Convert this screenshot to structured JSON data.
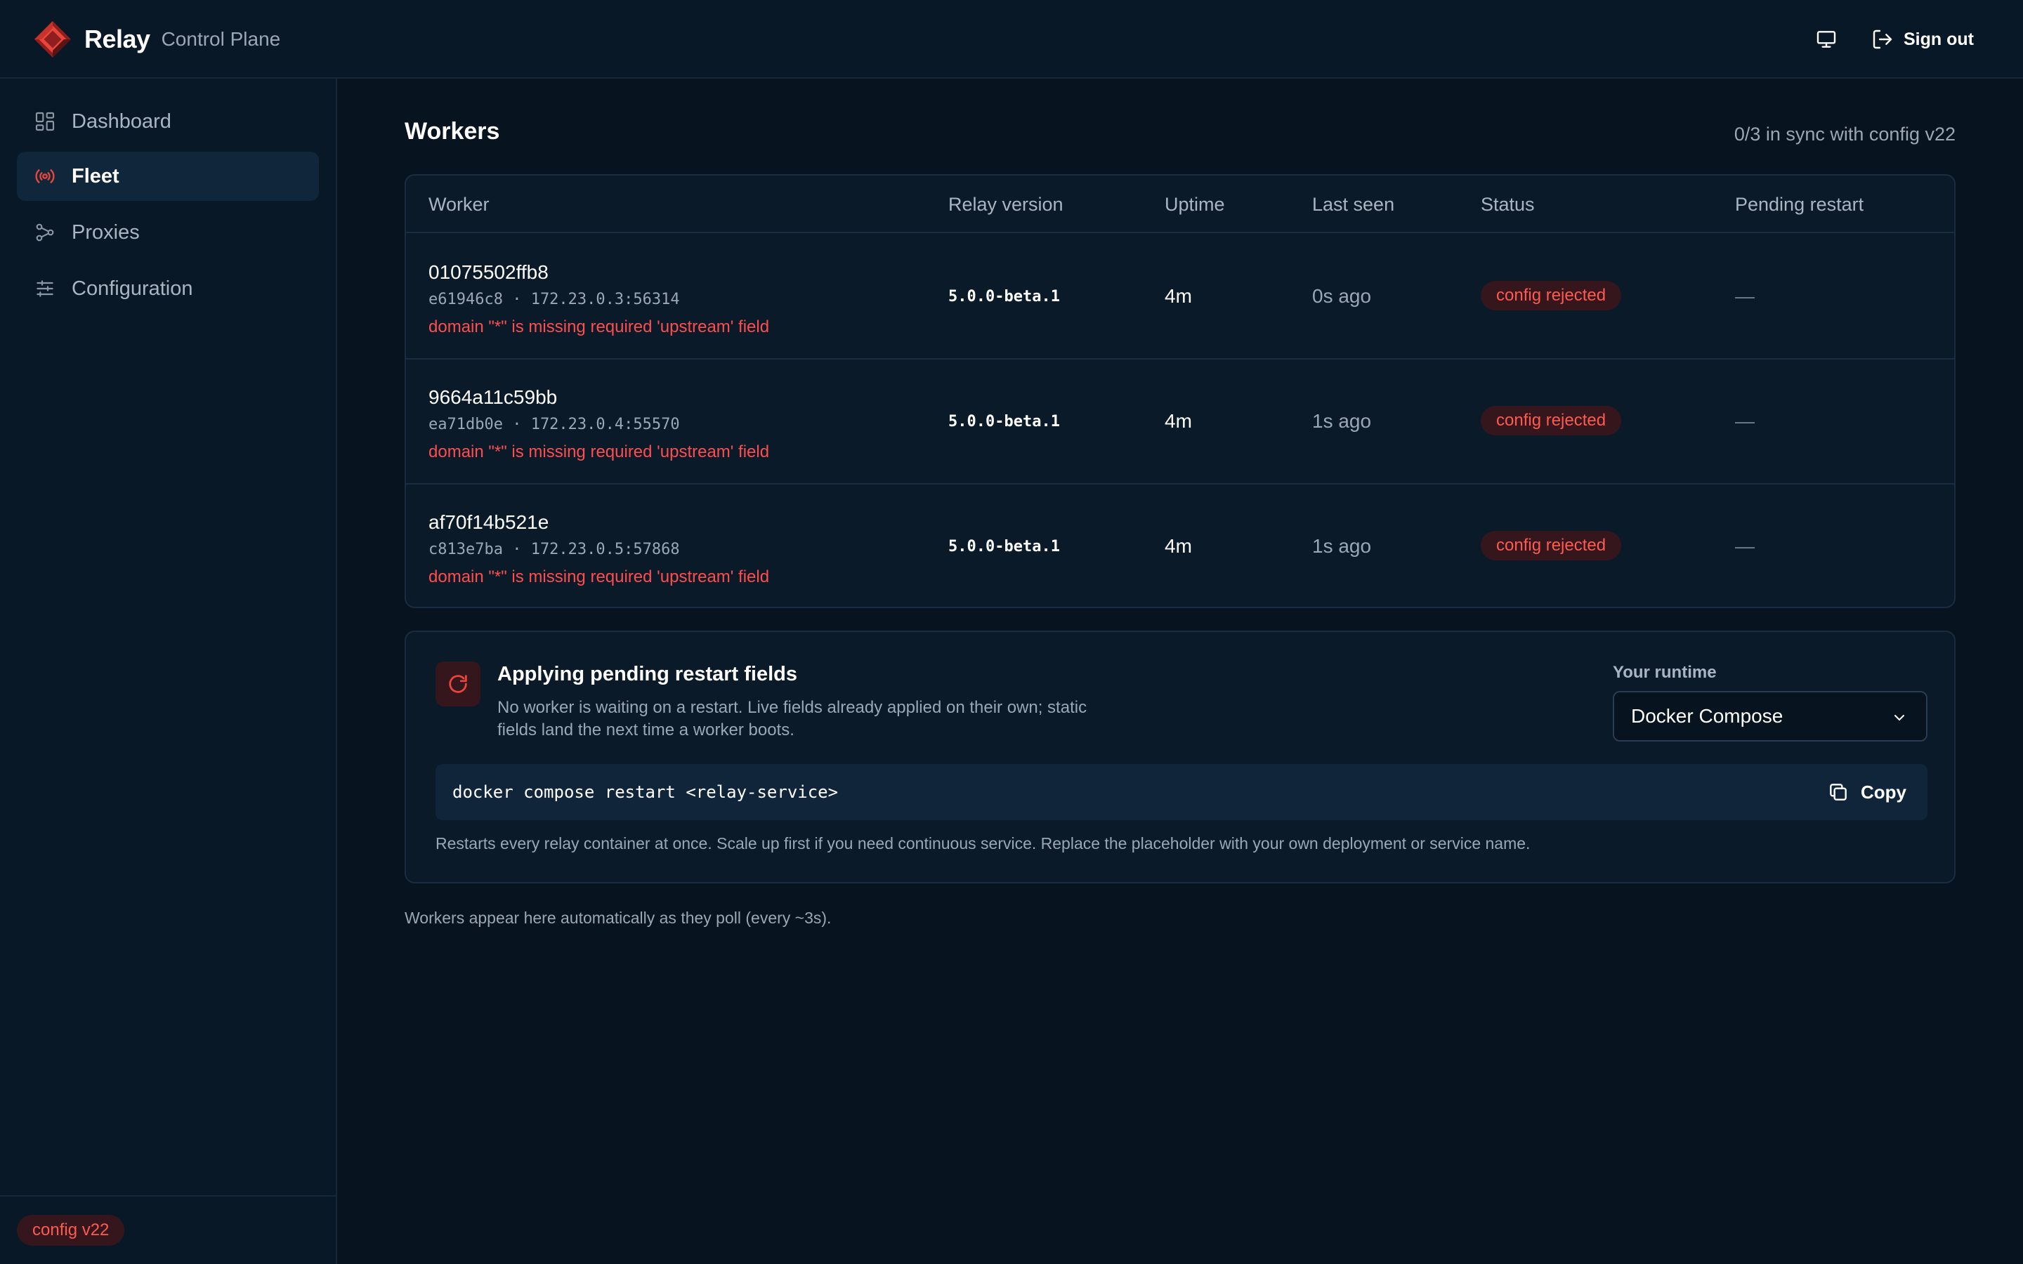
{
  "app": {
    "name": "Relay",
    "subtitle": "Control Plane",
    "sign_out_label": "Sign out",
    "accent_color": "#e8463a"
  },
  "sidebar": {
    "items": [
      {
        "label": "Dashboard",
        "icon": "grid-icon",
        "active": false
      },
      {
        "label": "Fleet",
        "icon": "broadcast-icon",
        "active": true
      },
      {
        "label": "Proxies",
        "icon": "network-icon",
        "active": false
      },
      {
        "label": "Configuration",
        "icon": "sliders-icon",
        "active": false
      }
    ],
    "config_badge": "config v22"
  },
  "main": {
    "title": "Workers",
    "sync_status": "0/3 in sync with config v22",
    "table": {
      "headers": [
        "Worker",
        "Relay version",
        "Uptime",
        "Last seen",
        "Status",
        "Pending restart"
      ],
      "rows": [
        {
          "id": "01075502ffb8",
          "meta": "e61946c8 · 172.23.0.3:56314",
          "error": "domain \"*\" is missing required 'upstream' field",
          "version": "5.0.0-beta.1",
          "uptime": "4m",
          "last_seen": "0s ago",
          "status": "config rejected",
          "pending": "—"
        },
        {
          "id": "9664a11c59bb",
          "meta": "ea71db0e · 172.23.0.4:55570",
          "error": "domain \"*\" is missing required 'upstream' field",
          "version": "5.0.0-beta.1",
          "uptime": "4m",
          "last_seen": "1s ago",
          "status": "config rejected",
          "pending": "—"
        },
        {
          "id": "af70f14b521e",
          "meta": "c813e7ba · 172.23.0.5:57868",
          "error": "domain \"*\" is missing required 'upstream' field",
          "version": "5.0.0-beta.1",
          "uptime": "4m",
          "last_seen": "1s ago",
          "status": "config rejected",
          "pending": "—"
        }
      ]
    },
    "restart": {
      "title": "Applying pending restart fields",
      "description": "No worker is waiting on a restart. Live fields already applied on their own; static fields land the next time a worker boots.",
      "runtime_label": "Your runtime",
      "runtime_value": "Docker Compose",
      "command": "docker compose restart <relay-service>",
      "copy_label": "Copy",
      "note": "Restarts every relay container at once. Scale up first if you need continuous service. Replace the placeholder with your own deployment or service name."
    },
    "footnote": "Workers appear here automatically as they poll (every ~3s)."
  }
}
